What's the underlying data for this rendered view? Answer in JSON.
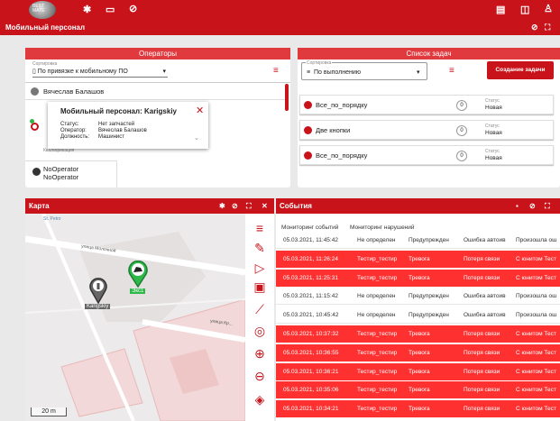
{
  "topbar": {
    "logo_text": "BEST MATE",
    "icons": [
      "gear-icon",
      "book-icon",
      "help-icon",
      "message-icon",
      "report-icon",
      "user-icon"
    ]
  },
  "titlebar": {
    "title": "Мобильный персонал"
  },
  "operators": {
    "header": "Операторы",
    "sort_label": "Сортировка",
    "sort_value": "По привязке к мобильному ПО",
    "rows": [
      {
        "name": "Вячеслав Балашов"
      },
      {
        "name": "NoOperator",
        "sub": "NoOperator"
      }
    ],
    "qualification_label": "Квалификация",
    "popup": {
      "title": "Мобильный персонал: Karigskiy",
      "status_label": "Статус:",
      "status_value": "Нет запчастей",
      "operator_label": "Оператор:",
      "operator_value": "Вячеслав Балашов",
      "position_label": "Должность:",
      "position_value": "Машинист"
    }
  },
  "tasks": {
    "header": "Список задач",
    "sort_label": "Сортировка",
    "sort_value": "По выполнению",
    "create_button": "Создание задачи",
    "status_label": "Статус",
    "items": [
      {
        "name": "Все_по_порядку",
        "count": "0",
        "status": "Новая"
      },
      {
        "name": "Две кнопки",
        "count": "0",
        "status": "Новая"
      },
      {
        "name": "Все_по_порядку",
        "count": "0",
        "status": "Новая"
      }
    ]
  },
  "map": {
    "header": "Карта",
    "street_1": "улица Молочной",
    "street_2": "улица Кр...",
    "marker_1": "Karigskiy",
    "marker_2": "Экс1",
    "scale": "20 m",
    "corner_label": "St. Petro"
  },
  "events": {
    "header": "События",
    "tab_1": "Мониторинг событий",
    "tab_2": "Мониторинг нарушений",
    "rows": [
      {
        "time": "05.03.2021, 11:45:42",
        "user": "Не определен",
        "level": "Предупрежден",
        "type": "Ошибка автоив",
        "desc": "Произошла ош",
        "alarm": false
      },
      {
        "time": "05.03.2021, 11:26:24",
        "user": "Тестир_тестир",
        "level": "Тревога",
        "type": "Потеря связи",
        "desc": "С юнитом Тест",
        "alarm": true
      },
      {
        "time": "05.03.2021, 11:25:31",
        "user": "Тестир_тестир",
        "level": "Тревога",
        "type": "Потеря связи",
        "desc": "С юнитом Тест",
        "alarm": true
      },
      {
        "time": "05.03.2021, 11:15:42",
        "user": "Не определен",
        "level": "Предупрежден",
        "type": "Ошибка автоив",
        "desc": "Произошла ош",
        "alarm": false
      },
      {
        "time": "05.03.2021, 10:45:42",
        "user": "Не определен",
        "level": "Предупрежден",
        "type": "Ошибка автоив",
        "desc": "Произошла ош",
        "alarm": false
      },
      {
        "time": "05.03.2021, 10:37:32",
        "user": "Тестир_тестир",
        "level": "Тревога",
        "type": "Потеря связи",
        "desc": "С юнитом Тест",
        "alarm": true
      },
      {
        "time": "05.03.2021, 10:36:55",
        "user": "Тестир_тестир",
        "level": "Тревога",
        "type": "Потеря связи",
        "desc": "С юнитом Тест",
        "alarm": true
      },
      {
        "time": "05.03.2021, 10:36:21",
        "user": "Тестир_тестир",
        "level": "Тревога",
        "type": "Потеря связи",
        "desc": "С юнитом Тест",
        "alarm": true
      },
      {
        "time": "05.03.2021, 10:35:06",
        "user": "Тестир_тестир",
        "level": "Тревога",
        "type": "Потеря связи",
        "desc": "С юнитом Тест",
        "alarm": true
      },
      {
        "time": "05.03.2021, 10:34:21",
        "user": "Тестир_тестир",
        "level": "Тревога",
        "type": "Потеря связи",
        "desc": "С юнитом Тест",
        "alarm": true
      }
    ]
  },
  "colors": {
    "brand_red": "#c8131b",
    "alarm_red": "#ff3030",
    "marker_green": "#2fb84a"
  }
}
